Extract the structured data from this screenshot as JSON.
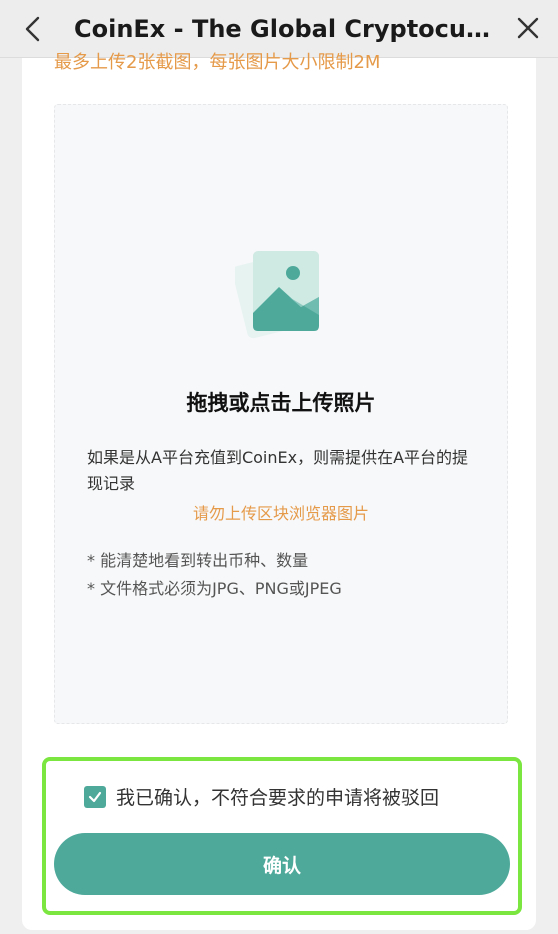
{
  "header": {
    "title": "CoinEx - The Global Cryptocurrency Exchange"
  },
  "upload": {
    "top_hint": "最多上传2张截图，每张图片大小限制2M",
    "drop_title": "拖拽或点击上传照片",
    "description": "如果是从A平台充值到CoinEx，则需提供在A平台的提现记录",
    "warning": "请勿上传区块浏览器图片",
    "requirements": [
      "* 能清楚地看到转出币种、数量",
      "* 文件格式必须为JPG、PNG或JPEG"
    ]
  },
  "confirm": {
    "checkbox_label": "我已确认，不符合要求的申请将被驳回",
    "button_label": "确认"
  },
  "colors": {
    "accent": "#4ea99b",
    "warning": "#e59a4a",
    "highlight_border": "#7be63f"
  },
  "icons": {
    "back": "chevron-left-icon",
    "close": "close-icon",
    "upload": "image-upload-icon",
    "check": "checkmark-icon"
  }
}
